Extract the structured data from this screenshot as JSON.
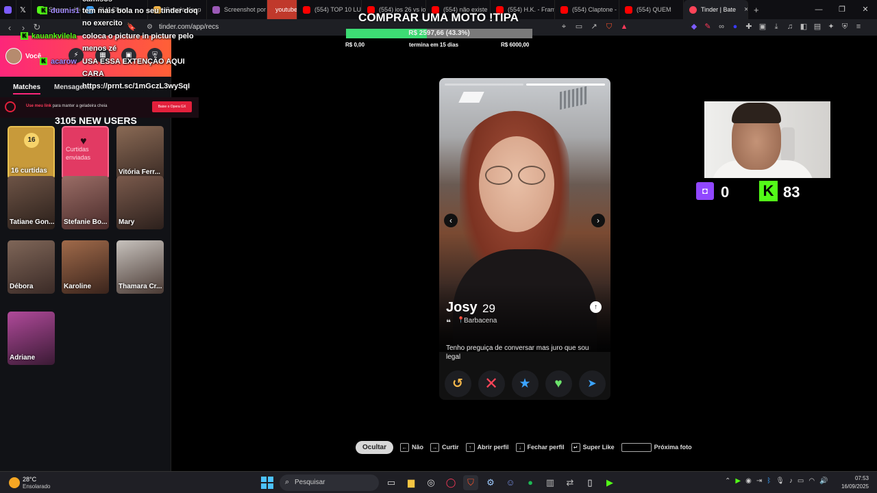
{
  "browser": {
    "tabs": [
      {
        "label": "",
        "color": "#7d5cff"
      },
      {
        "label": "",
        "color": "#ffffff"
      },
      {
        "label": "Stream - Kick",
        "color": "#53fc18"
      },
      {
        "label": "CLK Client",
        "color": "#3ca4ff"
      },
      {
        "label": "Google Keep",
        "color": "#f7b84b"
      },
      {
        "label": "Screenshot por L",
        "color": "#9b59b6"
      },
      {
        "label": "youtube",
        "color": "#c0392b"
      },
      {
        "label": "(554) TOP 10 LUT",
        "color": "#ff0000"
      },
      {
        "label": "(554) ios 26 vs io",
        "color": "#ff0000"
      },
      {
        "label": "(554) não existe",
        "color": "#ff0000"
      },
      {
        "label": "(554) H.K. - Fram",
        "color": "#ff0000"
      },
      {
        "label": "(554) Claptone -",
        "color": "#ff0000"
      },
      {
        "label": "(554) QUEM",
        "color": "#ff0000"
      },
      {
        "label": "Tinder | Bate",
        "color": "#ff4458"
      }
    ],
    "new_tab": "+",
    "url": "tinder.com/app/recs"
  },
  "goal": {
    "title": "COMPRAR UMA MOTO !TIPA",
    "progress_text": "R$ 2597,66 (43.3%)",
    "progress_fraction": 0.433,
    "min": "R$ 0,00",
    "ends": "termina em 15 dias",
    "max": "R$ 6000,00"
  },
  "chat": {
    "user1": "duunis1",
    "user2": "kauankvilela",
    "user3": "acarow",
    "line_a": "tem mais bola no seu tinder doq",
    "line_b": "no exercito",
    "line_c": "coloca o picture in picture pelo",
    "line_d": "menos zé",
    "line_e": "USA ESSA EXTENÇÃO AQUI",
    "line_f": "CARA",
    "line_g": "https://prnt.sc/1mGczL3wySqI",
    "overflow": "camisos"
  },
  "sidebar": {
    "me_label": "Você",
    "tab_matches": "Matches",
    "tab_messages": "Mensagens",
    "ad_text_a": "Use meu link",
    "ad_text_b": "para manter a geladeira cheia",
    "ad_button": "Baixe o Opera GX",
    "new_users": "3105 NEW USERS",
    "likes_count": "16",
    "likes_label": "16 curtidas",
    "sent_label": "Curtidas enviadas",
    "matches": [
      {
        "name": "Vitória Ferr..."
      },
      {
        "name": "Tatiane Gon..."
      },
      {
        "name": "Stefanie Bo..."
      },
      {
        "name": "Mary"
      },
      {
        "name": "Débora"
      },
      {
        "name": "Karoline"
      },
      {
        "name": "Thamara Cr..."
      },
      {
        "name": "Adriane"
      }
    ]
  },
  "profile": {
    "name": "Josy",
    "age": "29",
    "city": "Barbacena",
    "bio": "Tenho preguiça de conversar mas juro que sou legal",
    "photo_count": 2,
    "photo_index": 1
  },
  "stream_stats": {
    "twitch_viewers": "0",
    "kick_viewers": "83",
    "twitch_color": "#9147ff",
    "kick_color": "#53fc18"
  },
  "hints": {
    "hide": "Ocultar",
    "nope": "Não",
    "like": "Curtir",
    "open": "Abrir perfil",
    "close": "Fechar perfil",
    "super": "Super Like",
    "next": "Próxima foto"
  },
  "taskbar": {
    "temp": "28°C",
    "weather": "Ensolarado",
    "search": "Pesquisar",
    "time": "07:53",
    "date": "16/09/2025"
  }
}
